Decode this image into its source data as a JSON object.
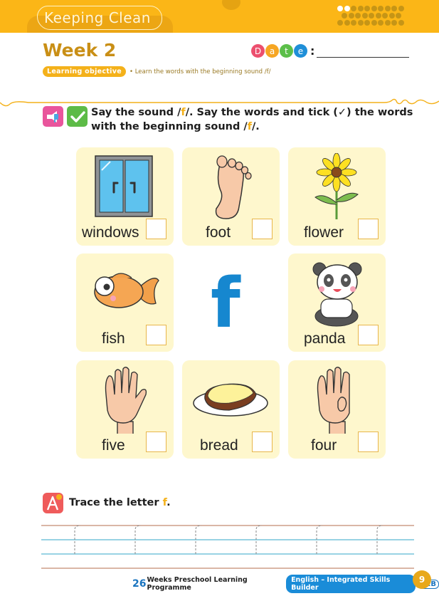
{
  "header": {
    "unit_title": "Keeping Clean",
    "progress": {
      "completed_weeks": 2,
      "total_weeks": 26
    }
  },
  "week": {
    "title": "Week 2",
    "date_letters": [
      {
        "char": "D",
        "color": "#ec4f6e"
      },
      {
        "char": "a",
        "color": "#f6a623"
      },
      {
        "char": "t",
        "color": "#5cbf4a"
      },
      {
        "char": "e",
        "color": "#1f8fd8"
      }
    ],
    "date_colon": ":",
    "objective_badge": "Learning objective",
    "objective_text": "• Learn the words with the beginning sound /f/"
  },
  "instruction": {
    "part1": "Say the sound /",
    "letter": "f",
    "part2": "/. Say the words and tick (✓) the words with the beginning sound /",
    "part3": "/."
  },
  "center_letter": "f",
  "cards": [
    {
      "word": "windows",
      "picture": "window-icon",
      "checked": false
    },
    {
      "word": "foot",
      "picture": "foot-icon",
      "checked": false
    },
    {
      "word": "flower",
      "picture": "flower-icon",
      "checked": false
    },
    {
      "word": "fish",
      "picture": "fish-icon",
      "checked": false
    },
    {
      "word": "panda",
      "picture": "panda-icon",
      "checked": false
    },
    {
      "word": "five",
      "picture": "hand-five-icon",
      "checked": false
    },
    {
      "word": "bread",
      "picture": "bread-icon",
      "checked": false
    },
    {
      "word": "four",
      "picture": "hand-four-icon",
      "checked": false
    }
  ],
  "trace": {
    "title_prefix": "Trace the letter ",
    "letter": "f",
    "title_suffix": ".",
    "guide_count": 6
  },
  "footer": {
    "weeks_number": "26",
    "programme": "Weeks Preschool Learning Programme",
    "subject": "English – Integrated Skills Builder",
    "level": "K2B",
    "page_number": "9"
  },
  "colors": {
    "header": "#fbb617",
    "accent": "#f4b11a",
    "card_bg": "#fef7cd",
    "letter_blue": "#1687cf"
  }
}
